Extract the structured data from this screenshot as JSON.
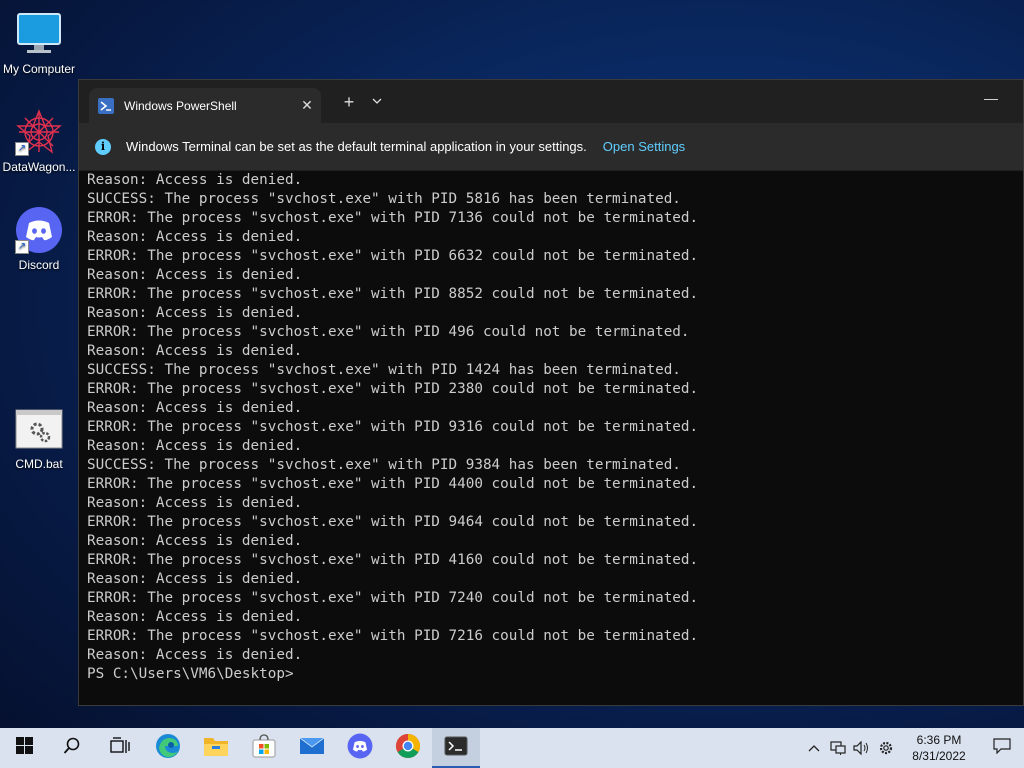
{
  "desktop": {
    "icons": [
      {
        "label": "My Computer",
        "icon": "monitor-icon"
      },
      {
        "label": "DataWagon...",
        "icon": "datawagon-icon"
      },
      {
        "label": "Discord",
        "icon": "discord-icon"
      },
      {
        "label": "CMD.bat",
        "icon": "batch-file-icon"
      }
    ]
  },
  "terminal": {
    "tab_title": "Windows PowerShell",
    "tab_icon": "powershell-icon",
    "new_tab_label": "+",
    "close_label": "✕",
    "minimize_label": "—",
    "infobar": {
      "text": "Windows Terminal can be set as the default terminal application in your settings.",
      "link": "Open Settings"
    },
    "lines": [
      "Reason: Access is denied.",
      "SUCCESS: The process \"svchost.exe\" with PID 5816 has been terminated.",
      "ERROR: The process \"svchost.exe\" with PID 7136 could not be terminated.",
      "Reason: Access is denied.",
      "ERROR: The process \"svchost.exe\" with PID 6632 could not be terminated.",
      "Reason: Access is denied.",
      "ERROR: The process \"svchost.exe\" with PID 8852 could not be terminated.",
      "Reason: Access is denied.",
      "ERROR: The process \"svchost.exe\" with PID 496 could not be terminated.",
      "Reason: Access is denied.",
      "SUCCESS: The process \"svchost.exe\" with PID 1424 has been terminated.",
      "ERROR: The process \"svchost.exe\" with PID 2380 could not be terminated.",
      "Reason: Access is denied.",
      "ERROR: The process \"svchost.exe\" with PID 9316 could not be terminated.",
      "Reason: Access is denied.",
      "SUCCESS: The process \"svchost.exe\" with PID 9384 has been terminated.",
      "ERROR: The process \"svchost.exe\" with PID 4400 could not be terminated.",
      "Reason: Access is denied.",
      "ERROR: The process \"svchost.exe\" with PID 9464 could not be terminated.",
      "Reason: Access is denied.",
      "ERROR: The process \"svchost.exe\" with PID 4160 could not be terminated.",
      "Reason: Access is denied.",
      "ERROR: The process \"svchost.exe\" with PID 7240 could not be terminated.",
      "Reason: Access is denied.",
      "ERROR: The process \"svchost.exe\" with PID 7216 could not be terminated.",
      "Reason: Access is denied.",
      "PS C:\\Users\\VM6\\Desktop>"
    ]
  },
  "taskbar": {
    "apps": [
      "start-icon",
      "search-icon",
      "task-view-icon",
      "edge-icon",
      "file-explorer-icon",
      "store-icon",
      "mail-icon",
      "discord-icon",
      "chrome-icon",
      "terminal-icon"
    ],
    "active_app": "terminal-icon",
    "clock": {
      "time": "6:36 PM",
      "date": "8/31/2022"
    }
  },
  "colors": {
    "console_bg": "#0c0c0c",
    "console_fg": "#cccccc",
    "accent": "#60cdff",
    "taskbar_bg": "#d9e2ee"
  }
}
